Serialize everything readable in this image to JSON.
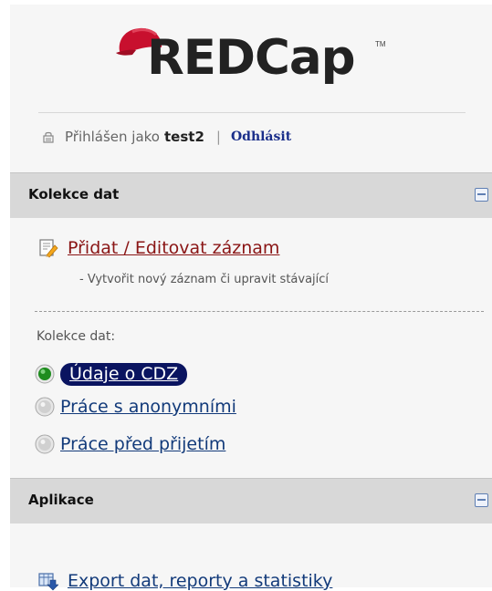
{
  "logo": {
    "text": "REDCap",
    "trademark": "TM"
  },
  "login": {
    "prefix": "Přihlášen jako",
    "username": "test2",
    "separator": "|",
    "logout_label": "Odhlásit"
  },
  "data_collection": {
    "header": "Kolekce dat",
    "add_edit_label": "Přidat / Editovat záznam",
    "add_edit_desc": "- Vytvořit nový záznam či upravit stávající",
    "instruments_label": "Kolekce dat:",
    "instruments": [
      {
        "label": "Údaje o CDZ",
        "status": "green",
        "active": true
      },
      {
        "label": "Práce s anonymními",
        "status": "gray",
        "active": false
      },
      {
        "label": "Práce před přijetím",
        "status": "gray",
        "active": false
      }
    ]
  },
  "applications": {
    "header": "Aplikace",
    "export_label": "Export dat, reporty a statistiky"
  },
  "colors": {
    "logo_red": "#c8102e",
    "link_red": "#8a1515",
    "link_blue": "#123a7a",
    "active_pill": "#0a1460",
    "status_green": "#1e8c1e"
  }
}
